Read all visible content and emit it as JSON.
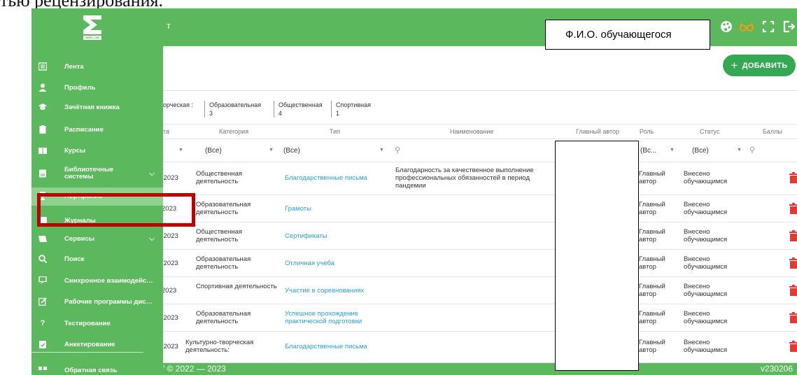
{
  "doc_text": "тью рецензирования.",
  "topbar": {
    "title_fragment": "т",
    "fio_label": "Ф.И.О. обучающегося"
  },
  "toolbar": {
    "add_label": "ДОБАВИТЬ",
    "add_icon": "+"
  },
  "categories": [
    {
      "name": "орческая :",
      "count": ""
    },
    {
      "name": "Образовательная",
      "count": "3"
    },
    {
      "name": "Общественная",
      "count": "4"
    },
    {
      "name": "Спортивная",
      "count": "1"
    }
  ],
  "columns": {
    "date": "та",
    "category": "Категория",
    "type": "Тип",
    "name": "Наименование",
    "author": "Главный автор",
    "role": "Роль",
    "status": "Статус",
    "score": "Баллы"
  },
  "filters": {
    "category": "(Все)",
    "type": "(Все)",
    "role": "(Вс...",
    "status": "(Все)"
  },
  "rows": [
    {
      "date": ".2023",
      "category": "Общественная деятельность",
      "type": "Благодарственные письма",
      "name": "Благодарность за качественное выполнение профессиональных обязанностей в период пандемии",
      "role": "Главный автор",
      "status": "Внесено обучающимся"
    },
    {
      "date": "2023",
      "category": "Образовательная деятельность",
      "type": "Грамоты",
      "name": "",
      "role": "Главный автор",
      "status": "Внесено обучающимся"
    },
    {
      "date": ".2023",
      "category": "Общественная деятельность",
      "type": "Сертификаты",
      "name": "",
      "role": "Главный автор",
      "status": "Внесено обучающимся"
    },
    {
      "date": ".2023",
      "category": "Образовательная деятельность",
      "type": "Отличная учеба",
      "name": "",
      "role": "Главный автор",
      "status": "Внесено обучающимся"
    },
    {
      "date": "2023",
      "category": "Спортивная деятельность",
      "type": "Участие в соревнованиях",
      "name": "",
      "role": "Главный автор",
      "status": "Внесено обучающимся"
    },
    {
      "date": ".2023",
      "category": "Образовательная деятельность",
      "type": "Успешное прохождение практической подготовки",
      "name": "",
      "role": "Главный автор",
      "status": "Внесено обучающимся"
    },
    {
      "date": ".2023",
      "category": "Культурно-творческая деятельность:",
      "type": "Благодарственные письма",
      "name": "",
      "role": "Главный автор",
      "status": "Внесено обучающимся"
    }
  ],
  "footer": {
    "copyright": "\" © 2022 — 2023",
    "version": "v230206"
  },
  "sidebar": {
    "logo_text": "MMIS LAB",
    "items": [
      {
        "label": "Лента",
        "icon": "newspaper-icon"
      },
      {
        "label": "Профиль",
        "icon": "user-icon"
      },
      {
        "label": "Зачётная книжка",
        "icon": "graduation-cap-icon"
      },
      {
        "label": "Расписание",
        "icon": "calendar-icon"
      },
      {
        "label": "Курсы",
        "icon": "book-icon"
      },
      {
        "label": "Библиотечные системы",
        "icon": "library-icon"
      },
      {
        "label": "Портфолио",
        "icon": "trophy-icon"
      },
      {
        "label": "Журналы",
        "icon": "journal-icon"
      },
      {
        "label": "Сервисы",
        "icon": "services-icon"
      },
      {
        "label": "Поиск",
        "icon": "search-icon"
      },
      {
        "label": "Синхронное взаимодейств...",
        "icon": "chat-icon"
      },
      {
        "label": "Рабочие программы дисц...",
        "icon": "edit-icon"
      },
      {
        "label": "Тестирование",
        "icon": "question-icon"
      },
      {
        "label": "Анкетирование",
        "icon": "survey-icon"
      },
      {
        "label": "Обратная связь",
        "icon": "feedback-icon"
      }
    ]
  }
}
